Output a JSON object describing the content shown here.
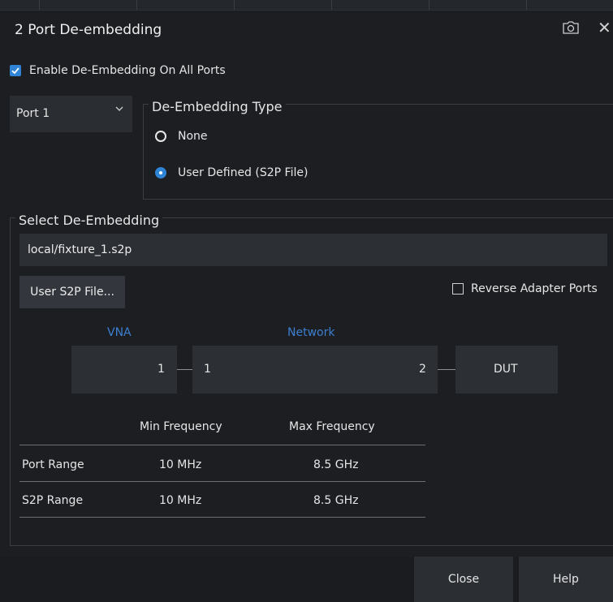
{
  "dialog": {
    "title": "2 Port De-embedding",
    "enable_label": "Enable De-Embedding On All Ports",
    "enable_checked": true
  },
  "port_select": {
    "value": "Port 1"
  },
  "deembed_type": {
    "title": "De-Embedding Type",
    "options": [
      "None",
      "User Defined (S2P File)"
    ],
    "selected": "User Defined (S2P File)"
  },
  "select_deembedding": {
    "title": "Select De-Embedding",
    "file_path": "local/fixture_1.s2p",
    "user_file_button": "User S2P File...",
    "reverse_label": "Reverse Adapter Ports",
    "reverse_checked": false
  },
  "diagram": {
    "vna_label": "VNA",
    "network_label": "Network",
    "vna_port": "1",
    "network_port_in": "1",
    "network_port_out": "2",
    "dut_label": "DUT"
  },
  "range_table": {
    "headers": [
      "Min Frequency",
      "Max Frequency"
    ],
    "rows": [
      {
        "label": "Port Range",
        "min": "10 MHz",
        "max": "8.5 GHz"
      },
      {
        "label": "S2P Range",
        "min": "10 MHz",
        "max": "8.5 GHz"
      }
    ]
  },
  "footer": {
    "close": "Close",
    "help": "Help"
  },
  "colors": {
    "accent": "#2f84d6",
    "diagram_label": "#3d7fd0",
    "background": "#1c1e22"
  }
}
